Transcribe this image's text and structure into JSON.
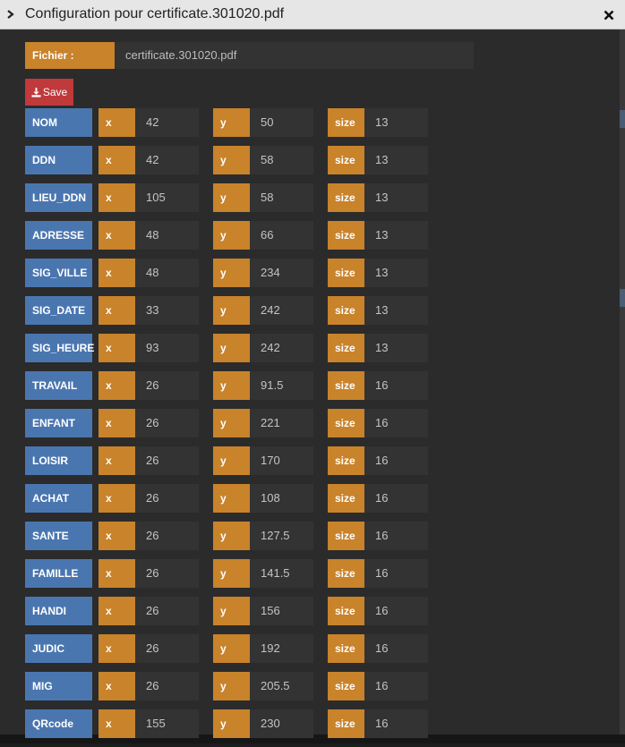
{
  "title": "Configuration pour certificate.301020.pdf",
  "file": {
    "label": "Fichier :",
    "value": "certificate.301020.pdf"
  },
  "save_label": "Save",
  "labels": {
    "x": "x",
    "y": "y",
    "size": "size"
  },
  "rows": [
    {
      "name": "NOM",
      "x": "42",
      "y": "50",
      "size": "13"
    },
    {
      "name": "DDN",
      "x": "42",
      "y": "58",
      "size": "13"
    },
    {
      "name": "LIEU_DDN",
      "x": "105",
      "y": "58",
      "size": "13"
    },
    {
      "name": "ADRESSE",
      "x": "48",
      "y": "66",
      "size": "13"
    },
    {
      "name": "SIG_VILLE",
      "x": "48",
      "y": "234",
      "size": "13"
    },
    {
      "name": "SIG_DATE",
      "x": "33",
      "y": "242",
      "size": "13"
    },
    {
      "name": "SIG_HEURE",
      "x": "93",
      "y": "242",
      "size": "13"
    },
    {
      "name": "TRAVAIL",
      "x": "26",
      "y": "91.5",
      "size": "16"
    },
    {
      "name": "ENFANT",
      "x": "26",
      "y": "221",
      "size": "16"
    },
    {
      "name": "LOISIR",
      "x": "26",
      "y": "170",
      "size": "16"
    },
    {
      "name": "ACHAT",
      "x": "26",
      "y": "108",
      "size": "16"
    },
    {
      "name": "SANTE",
      "x": "26",
      "y": "127.5",
      "size": "16"
    },
    {
      "name": "FAMILLE",
      "x": "26",
      "y": "141.5",
      "size": "16"
    },
    {
      "name": "HANDI",
      "x": "26",
      "y": "156",
      "size": "16"
    },
    {
      "name": "JUDIC",
      "x": "26",
      "y": "192",
      "size": "16"
    },
    {
      "name": "MIG",
      "x": "26",
      "y": "205.5",
      "size": "16"
    },
    {
      "name": "QRcode",
      "x": "155",
      "y": "230",
      "size": "16"
    }
  ],
  "colors": {
    "name_bg": "#4a76b0",
    "tag_bg": "#c8832b",
    "save_bg": "#c0393b",
    "panel_bg": "#2b2b2b"
  },
  "icons": {
    "collapse": "chevron-right-icon",
    "close": "close-icon",
    "save": "download-icon"
  }
}
